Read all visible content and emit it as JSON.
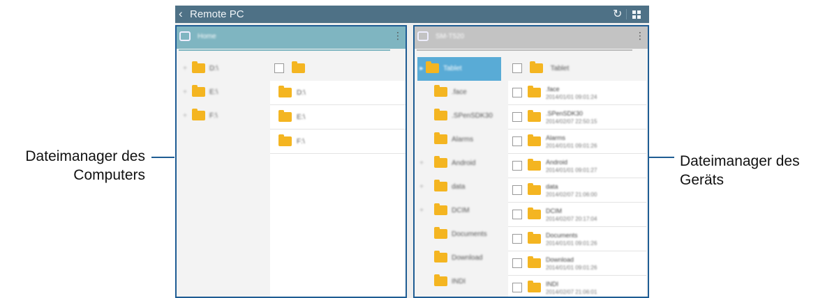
{
  "callouts": {
    "left": {
      "line1": "Dateimanager des",
      "line2": "Computers"
    },
    "right": {
      "line1": "Dateimanager des",
      "line2": "Geräts"
    }
  },
  "topbar": {
    "back_icon": "chevron-left-icon",
    "title": "Remote PC",
    "refresh_icon": "refresh-icon",
    "grid_icon": "grid-icon"
  },
  "left_pane": {
    "header": {
      "name": "Home",
      "icon": "computer-icon"
    },
    "tree": [
      {
        "label": "D:\\"
      },
      {
        "label": "E:\\"
      },
      {
        "label": "F:\\"
      }
    ],
    "list_rows": [
      {
        "name": "D:\\"
      },
      {
        "name": "E:\\"
      },
      {
        "name": "F:\\"
      }
    ]
  },
  "right_pane": {
    "header": {
      "name": "SM-T520",
      "icon": "tablet-icon"
    },
    "tree": [
      {
        "label": "Tablet",
        "selected": true,
        "expandable": false
      },
      {
        "label": ".face",
        "expandable": false
      },
      {
        "label": ".SPenSDK30",
        "expandable": false
      },
      {
        "label": "Alarms",
        "expandable": false
      },
      {
        "label": "Android",
        "expandable": true
      },
      {
        "label": "data",
        "expandable": true
      },
      {
        "label": "DCIM",
        "expandable": true
      },
      {
        "label": "Documents",
        "expandable": false
      },
      {
        "label": "Download",
        "expandable": false
      },
      {
        "label": "INDI",
        "expandable": false
      }
    ],
    "list_header": "Tablet",
    "list_rows": [
      {
        "name": ".face",
        "date": "2014/01/01 09:01:24"
      },
      {
        "name": ".SPenSDK30",
        "date": "2014/02/07 22:50:15"
      },
      {
        "name": "Alarms",
        "date": "2014/01/01 09:01:26"
      },
      {
        "name": "Android",
        "date": "2014/01/01 09:01:27"
      },
      {
        "name": "data",
        "date": "2014/02/07 21:06:00"
      },
      {
        "name": "DCIM",
        "date": "2014/02/07 20:17:04"
      },
      {
        "name": "Documents",
        "date": "2014/01/01 09:01:26"
      },
      {
        "name": "Download",
        "date": "2014/01/01 09:01:26"
      },
      {
        "name": "INDI",
        "date": "2014/02/07 21:06:01"
      }
    ]
  },
  "colors": {
    "topbar": "#4e7186",
    "highlight": "#1e5c93",
    "left_header": "#7fb5c1",
    "right_header": "#c3c3c3",
    "selected": "#59abd6",
    "folder": "#f4b521"
  }
}
